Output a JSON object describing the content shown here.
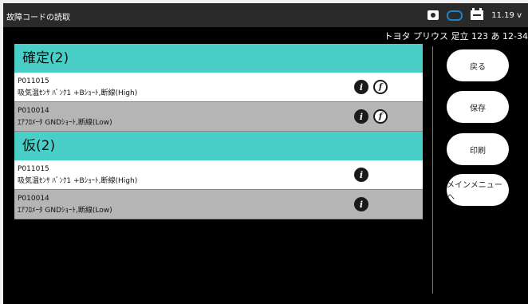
{
  "header": {
    "title": "故障コードの読取",
    "voltage": "11.19 v",
    "icons": [
      "camera-icon",
      "vci-icon",
      "battery-icon"
    ]
  },
  "vehicle": "トヨタ プリウス 足立 123 あ 12-34",
  "sections": [
    {
      "heading": "確定(2)",
      "rows": [
        {
          "code": "P011015",
          "desc": "吸気温ｾﾝｻ ﾊﾞﾝｸ1 +Bｼｮｰﾄ,断線(High)",
          "icons": [
            "info",
            "freeze-frame"
          ]
        },
        {
          "code": "P010014",
          "desc": "ｴｱﾌﾛﾒｰﾀ GNDｼｮｰﾄ,断線(Low)",
          "icons": [
            "info",
            "freeze-frame"
          ]
        }
      ]
    },
    {
      "heading": "仮(2)",
      "rows": [
        {
          "code": "P011015",
          "desc": "吸気温ｾﾝｻ ﾊﾞﾝｸ1 +Bｼｮｰﾄ,断線(High)",
          "icons": [
            "info"
          ]
        },
        {
          "code": "P010014",
          "desc": "ｴｱﾌﾛﾒｰﾀ GNDｼｮｰﾄ,断線(Low)",
          "icons": [
            "info"
          ]
        }
      ]
    }
  ],
  "buttons": {
    "back": "戻る",
    "save": "保存",
    "print": "印刷",
    "main_menu": "メインメニューへ"
  },
  "colors": {
    "section_header": "#49cfc7",
    "row_light": "#ffffff",
    "row_dark": "#b5b5b5",
    "vci_icon": "#1f82c8"
  }
}
